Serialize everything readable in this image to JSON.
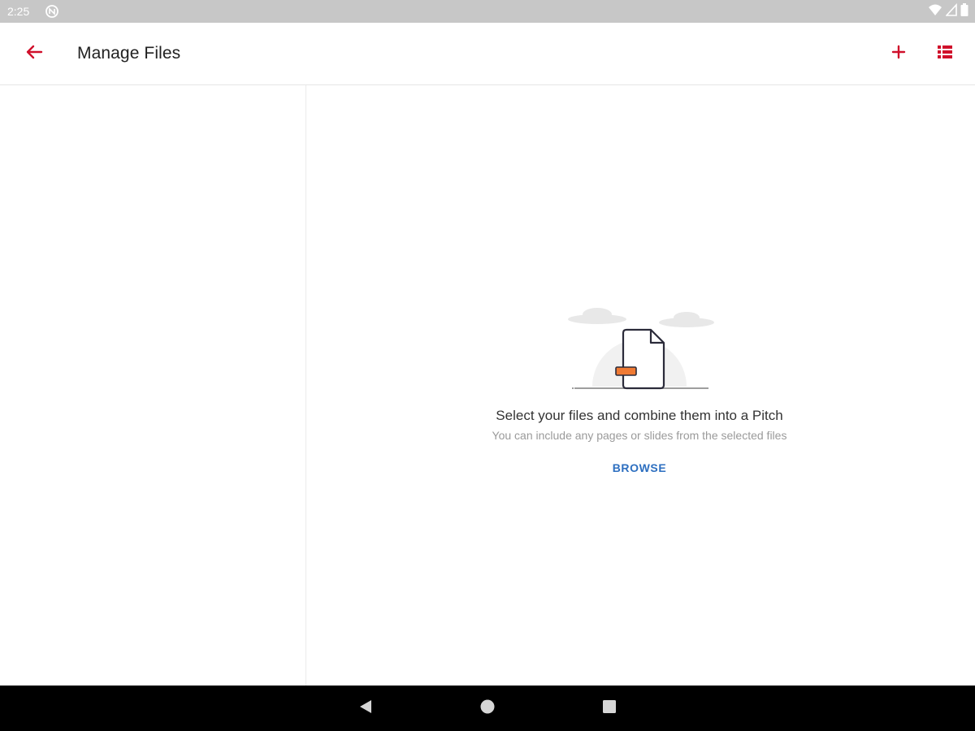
{
  "status_bar": {
    "time": "2:25",
    "icons": [
      "notification-icon",
      "wifi-icon",
      "signal-icon",
      "battery-icon"
    ]
  },
  "app_bar": {
    "title": "Manage Files",
    "back_icon": "arrow-back-icon",
    "add_icon": "plus-icon",
    "view_icon": "list-view-icon",
    "accent_color": "#d0102b"
  },
  "empty_state": {
    "title": "Select your files and combine them into a Pitch",
    "subtitle": "You can include any pages or slides from the selected files",
    "browse_label": "BROWSE",
    "browse_color": "#2d6fc0",
    "illustration": "empty-file-illustration"
  },
  "nav_bar": {
    "buttons": [
      "nav-back-icon",
      "nav-home-icon",
      "nav-recents-icon"
    ]
  }
}
